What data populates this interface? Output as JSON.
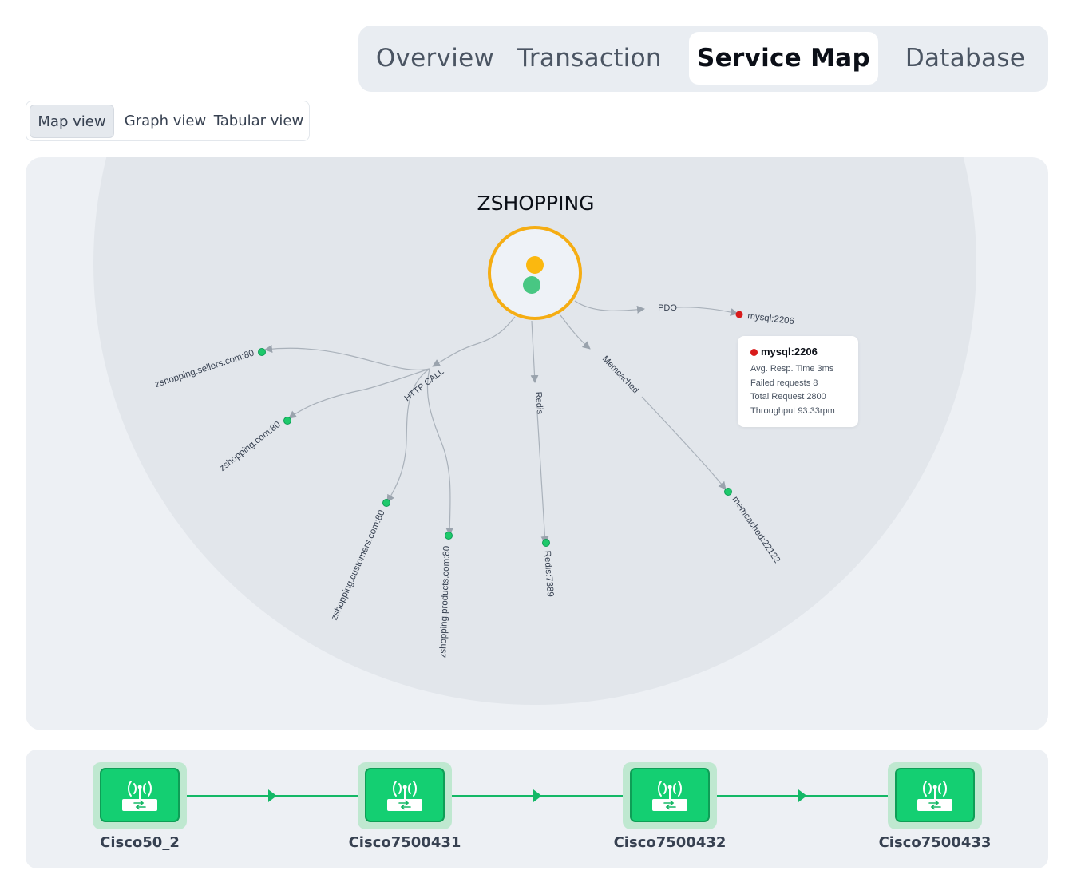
{
  "tabs": [
    {
      "label": "Overview",
      "active": false
    },
    {
      "label": "Transaction",
      "active": false
    },
    {
      "label": "Service Map",
      "active": true
    },
    {
      "label": "Database",
      "active": false
    }
  ],
  "view_switch": [
    {
      "label": "Map view",
      "active": true
    },
    {
      "label": "Graph view",
      "active": false
    },
    {
      "label": "Tabular view",
      "active": false
    }
  ],
  "map": {
    "app_name": "ZSHOPPING",
    "edge_labels": {
      "pdo": "PDO",
      "http": "HTTP CALL",
      "redis": "Redis",
      "memcached": "Memcached"
    },
    "nodes": {
      "mysql": "mysql:2206",
      "sellers": "zshopping.sellers.com:80",
      "zshop": "zshopping.com:80",
      "customers": "zshopping.customers.com:80",
      "products": "zshopping.products.com:80",
      "redis": "Redis:7389",
      "memcached": "memcached:22122"
    },
    "tooltip": {
      "title": "mysql:2206",
      "rows": [
        "Avg. Resp. Time 3ms",
        "Failed requests 8",
        "Total Request 2800",
        "Throughput 93.33rpm"
      ]
    },
    "colors": {
      "healthy": "#1ec96b",
      "critical": "#d81b1b",
      "warning": "#fbb80f",
      "ring": "#f5ad13"
    }
  },
  "devices": [
    {
      "name": "Cisco50_2",
      "icon": "router-icon"
    },
    {
      "name": "Cisco7500431",
      "icon": "router-icon"
    },
    {
      "name": "Cisco7500432",
      "icon": "router-icon"
    },
    {
      "name": "Cisco7500433",
      "icon": "router-icon"
    }
  ]
}
